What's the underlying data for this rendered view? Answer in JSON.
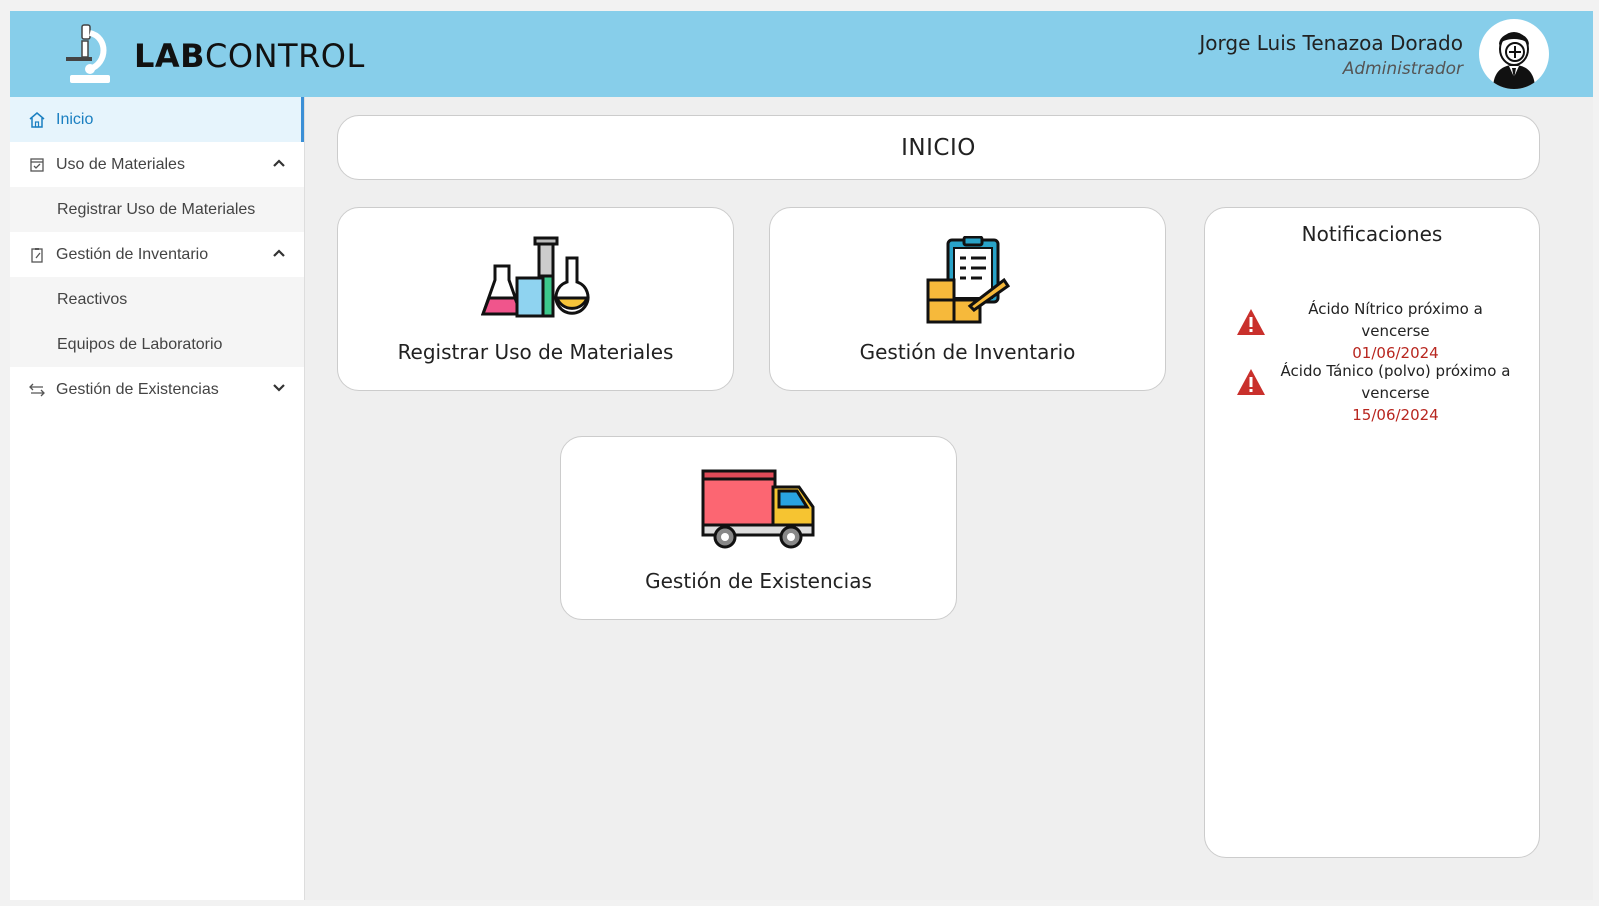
{
  "header": {
    "logo_bold": "LAB",
    "logo_regular": "CONTROL",
    "user_name": "Jorge Luis Tenazoa Dorado",
    "user_role": "Administrador",
    "background_color": "#87ceea"
  },
  "sidebar": {
    "items": [
      {
        "label": "Inicio",
        "icon": "home-icon",
        "active": true
      },
      {
        "label": "Uso de Materiales",
        "icon": "checkbox-calendar-icon",
        "expanded": true,
        "children": [
          {
            "label": "Registrar Uso de Materiales"
          }
        ]
      },
      {
        "label": "Gestión de Inventario",
        "icon": "clipboard-edit-icon",
        "expanded": true,
        "children": [
          {
            "label": "Reactivos"
          },
          {
            "label": "Equipos de Laboratorio"
          }
        ]
      },
      {
        "label": "Gestión de Existencias",
        "icon": "transfer-arrows-icon",
        "expanded": false
      }
    ]
  },
  "main": {
    "title": "INICIO",
    "cards": [
      {
        "label": "Registrar Uso de Materiales",
        "icon": "lab-flasks-icon"
      },
      {
        "label": "Gestión de Inventario",
        "icon": "inventory-clipboard-icon"
      },
      {
        "label": "Gestión de Existencias",
        "icon": "delivery-truck-icon"
      }
    ]
  },
  "notifications": {
    "title": "Notificaciones",
    "items": [
      {
        "text": "Ácido Nítrico próximo a vencerse",
        "date": "01/06/2024"
      },
      {
        "text": "Ácido Tánico (polvo) próximo a vencerse",
        "date": "15/06/2024"
      }
    ],
    "date_color": "#b8261f"
  }
}
